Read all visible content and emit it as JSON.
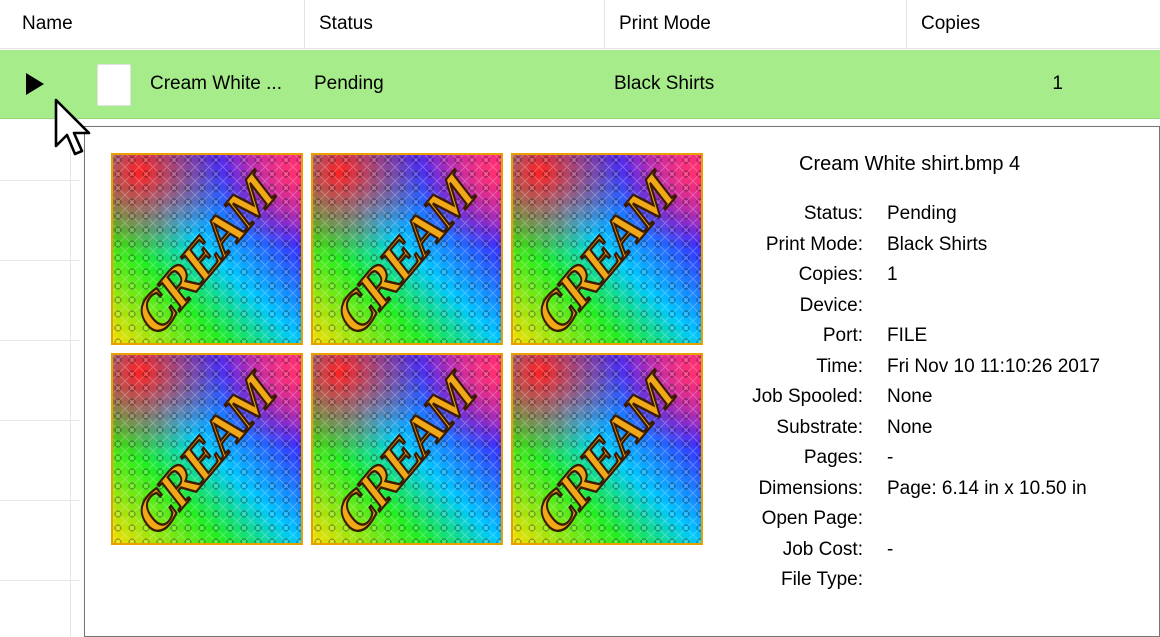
{
  "columns": [
    "Name",
    "Status",
    "Print Mode",
    "Copies"
  ],
  "job": {
    "name": "Cream White ...",
    "status": "Pending",
    "print_mode": "Black Shirts",
    "copies": "1"
  },
  "selection_color": "#a6ec8a",
  "tooltip": {
    "title": "Cream White shirt.bmp 4",
    "preview_word": "CREAM",
    "details": [
      {
        "label": "Status:",
        "value": "Pending"
      },
      {
        "label": "Print Mode:",
        "value": "Black Shirts"
      },
      {
        "label": "Copies:",
        "value": "1"
      },
      {
        "label": "Device:",
        "value": ""
      },
      {
        "label": "Port:",
        "value": "FILE"
      },
      {
        "label": "Time:",
        "value": "Fri Nov 10 11:10:26 2017"
      },
      {
        "label": "Job Spooled:",
        "value": "None"
      },
      {
        "label": "Substrate:",
        "value": "None"
      },
      {
        "label": "Pages:",
        "value": "-"
      },
      {
        "label": "Dimensions:",
        "value": "Page: 6.14 in x 10.50 in"
      },
      {
        "label": "Open Page:",
        "value": ""
      },
      {
        "label": "Job Cost:",
        "value": "-"
      },
      {
        "label": "File Type:",
        "value": ""
      }
    ]
  },
  "icons": {
    "row_marker": "play-arrow-icon",
    "file": "file-thumbnail-icon",
    "pointer": "mouse-pointer-icon"
  }
}
